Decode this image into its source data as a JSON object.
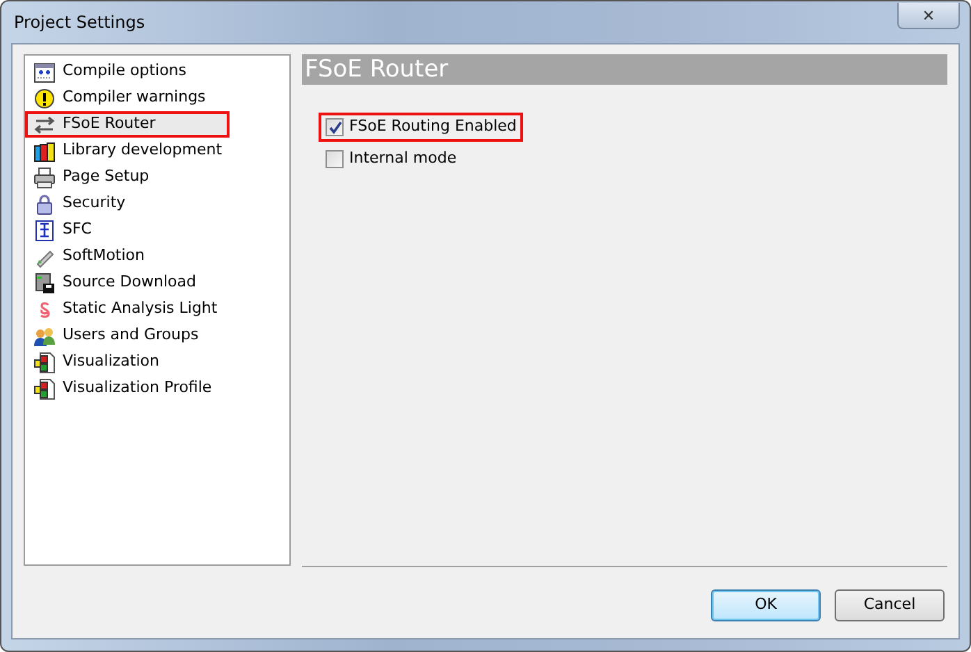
{
  "window": {
    "title": "Project Settings",
    "close": "✕"
  },
  "sidebar": {
    "items": [
      {
        "label": "Compile options",
        "selected": false,
        "highlighted": false
      },
      {
        "label": "Compiler warnings",
        "selected": false,
        "highlighted": false
      },
      {
        "label": "FSoE Router",
        "selected": true,
        "highlighted": true
      },
      {
        "label": "Library development",
        "selected": false,
        "highlighted": false
      },
      {
        "label": "Page Setup",
        "selected": false,
        "highlighted": false
      },
      {
        "label": "Security",
        "selected": false,
        "highlighted": false
      },
      {
        "label": "SFC",
        "selected": false,
        "highlighted": false
      },
      {
        "label": "SoftMotion",
        "selected": false,
        "highlighted": false
      },
      {
        "label": "Source Download",
        "selected": false,
        "highlighted": false
      },
      {
        "label": "Static Analysis Light",
        "selected": false,
        "highlighted": false
      },
      {
        "label": "Users and Groups",
        "selected": false,
        "highlighted": false
      },
      {
        "label": "Visualization",
        "selected": false,
        "highlighted": false
      },
      {
        "label": "Visualization Profile",
        "selected": false,
        "highlighted": false
      }
    ]
  },
  "panel": {
    "title": "FSoE Router",
    "options": [
      {
        "label": "FSoE Routing Enabled",
        "checked": true,
        "highlighted": true
      },
      {
        "label": "Internal mode",
        "checked": false,
        "highlighted": false
      }
    ]
  },
  "buttons": [
    {
      "label": "OK",
      "default": true
    },
    {
      "label": "Cancel",
      "default": false
    }
  ]
}
